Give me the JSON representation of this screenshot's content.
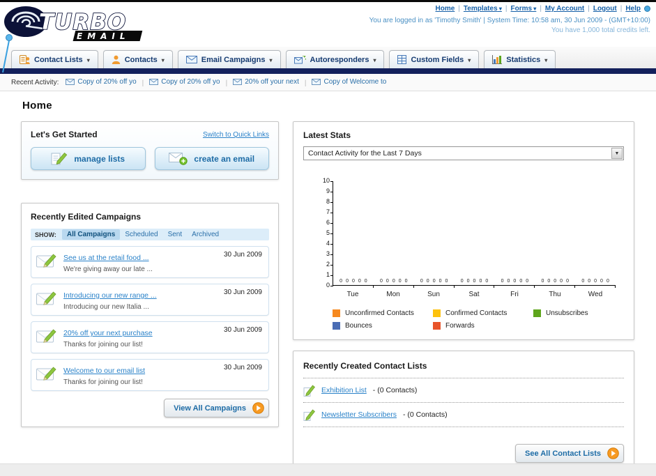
{
  "page_title": "Home",
  "logo": {
    "main": "TURBO",
    "sub": "EMAIL"
  },
  "header": {
    "links": [
      {
        "label": "Home",
        "dropdown": false
      },
      {
        "label": "Templates",
        "dropdown": true
      },
      {
        "label": "Forms",
        "dropdown": true
      },
      {
        "label": "My Account",
        "dropdown": false
      },
      {
        "label": "Logout",
        "dropdown": false
      },
      {
        "label": "Help",
        "dropdown": false
      }
    ],
    "login_info": "You are logged in as 'Timothy Smith' | System Time: 10:58 am, 30 Jun 2009 - (GMT+10:00)",
    "credits_info": "You have 1,000 total credits left."
  },
  "nav": {
    "tabs": [
      {
        "label": "Contact Lists",
        "icon": "contact-lists-icon"
      },
      {
        "label": "Contacts",
        "icon": "contacts-icon"
      },
      {
        "label": "Email Campaigns",
        "icon": "email-campaigns-icon"
      },
      {
        "label": "Autoresponders",
        "icon": "autoresponders-icon"
      },
      {
        "label": "Custom Fields",
        "icon": "custom-fields-icon"
      },
      {
        "label": "Statistics",
        "icon": "statistics-icon"
      }
    ]
  },
  "recent_activity": {
    "label": "Recent Activity:",
    "items": [
      "Copy of 20% off yo",
      "Copy of 20% off yo",
      "20% off your next",
      "Copy of Welcome to"
    ]
  },
  "get_started": {
    "title": "Let's Get Started",
    "switch_link": "Switch to Quick Links",
    "buttons": [
      {
        "label": "manage lists",
        "icon": "manage-lists-icon"
      },
      {
        "label": "create an email",
        "icon": "create-email-icon"
      }
    ]
  },
  "campaigns": {
    "title": "Recently Edited Campaigns",
    "show_label": "SHOW:",
    "filters": [
      "All Campaigns",
      "Scheduled",
      "Sent",
      "Archived"
    ],
    "active_filter": "All Campaigns",
    "items": [
      {
        "title": "See us at the retail food ...",
        "subtitle": "We're giving away our late ...",
        "date": "30 Jun 2009"
      },
      {
        "title": "Introducing our new range ...",
        "subtitle": "Introducing our new Italia ...",
        "date": "30 Jun 2009"
      },
      {
        "title": "20% off your next purchase",
        "subtitle": "Thanks for joining our list!",
        "date": "30 Jun 2009"
      },
      {
        "title": "Welcome to our email list",
        "subtitle": "Thanks for joining our list!",
        "date": "30 Jun 2009"
      }
    ],
    "view_all_label": "View All Campaigns"
  },
  "latest_stats": {
    "title": "Latest Stats",
    "period_selector": "Contact Activity for the Last 7 Days"
  },
  "chart_data": {
    "type": "bar",
    "title": "Contact Activity for the Last 7 Days",
    "categories": [
      "Tue",
      "Mon",
      "Sun",
      "Sat",
      "Fri",
      "Thu",
      "Wed"
    ],
    "series": [
      {
        "name": "Unconfirmed Contacts",
        "color": "#f6891f",
        "values": [
          0,
          0,
          0,
          0,
          0,
          0,
          0
        ]
      },
      {
        "name": "Confirmed Contacts",
        "color": "#fdc20e",
        "values": [
          0,
          0,
          0,
          0,
          0,
          0,
          0
        ]
      },
      {
        "name": "Unsubscribes",
        "color": "#5ea51c",
        "values": [
          0,
          0,
          0,
          0,
          0,
          0,
          0
        ]
      },
      {
        "name": "Bounces",
        "color": "#4a6db5",
        "values": [
          0,
          0,
          0,
          0,
          0,
          0,
          0
        ]
      },
      {
        "name": "Forwards",
        "color": "#e8542a",
        "values": [
          0,
          0,
          0,
          0,
          0,
          0,
          0
        ]
      }
    ],
    "ylim": [
      0,
      10
    ],
    "yticks": [
      0,
      1,
      2,
      3,
      4,
      5,
      6,
      7,
      8,
      9,
      10
    ],
    "grid": false,
    "legend_position": "bottom",
    "value_labels": true
  },
  "contact_lists": {
    "title": "Recently Created Contact Lists",
    "items": [
      {
        "name": "Exhibition List",
        "count": "(0 Contacts)"
      },
      {
        "name": "Newsletter Subscribers",
        "count": "(0 Contacts)"
      }
    ],
    "see_all_label": "See All Contact Lists"
  }
}
